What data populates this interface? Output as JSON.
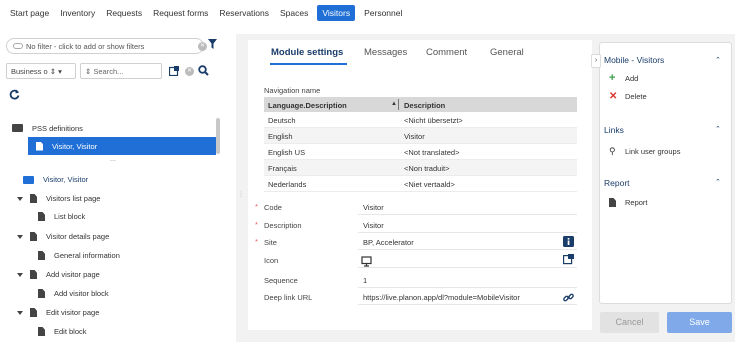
{
  "topnav": {
    "items": [
      "Start page",
      "Inventory",
      "Requests",
      "Request forms",
      "Reservations",
      "Spaces",
      "Visitors",
      "Personnel"
    ],
    "active_index": 6
  },
  "left": {
    "filter_text": "No filter - click to add or show filters",
    "business_object_label": "Business o",
    "search_placeholder": "Search...",
    "tree": {
      "root_label": "PSS definitions",
      "selected_label": "Visitor, Visitor",
      "more": "..."
    },
    "outline": [
      "Visitor, Visitor",
      "Visitors list page",
      "List block",
      "Visitor details page",
      "General information",
      "Add visitor page",
      "Add visitor block",
      "Edit visitor page",
      "Edit block"
    ]
  },
  "main": {
    "tabs": [
      "Module settings",
      "Messages",
      "Comment",
      "General"
    ],
    "active_tab": 0,
    "navigation_name_label": "Navigation name",
    "grid": {
      "headers": [
        "Language.Description",
        "Description"
      ],
      "rows": [
        [
          "Deutsch",
          "<Nicht übersetzt>"
        ],
        [
          "English",
          "Visitor"
        ],
        [
          "English US",
          "<Not translated>"
        ],
        [
          "Français",
          "<Non traduit>"
        ],
        [
          "Nederlands",
          "<Niet vertaald>"
        ]
      ]
    },
    "fields": [
      {
        "label": "Code",
        "value": "Visitor",
        "required": true
      },
      {
        "label": "Description",
        "value": "Visitor",
        "required": true
      },
      {
        "label": "Site",
        "value": "BP, Accelerator",
        "required": true
      },
      {
        "label": "Icon",
        "value": "",
        "required": false
      },
      {
        "label": "Sequence",
        "value": "1",
        "required": false
      },
      {
        "label": "Deep link URL",
        "value": "https://live.planon.app/dl?module=MobileVisitor",
        "required": false
      }
    ]
  },
  "side": {
    "sections": [
      {
        "title": "Mobile - Visitors",
        "items": [
          "Add",
          "Delete"
        ]
      },
      {
        "title": "Links",
        "items": [
          "Link user groups"
        ]
      },
      {
        "title": "Report",
        "items": [
          "Report"
        ]
      }
    ],
    "cancel_label": "Cancel",
    "save_label": "Save"
  },
  "colors": {
    "accent": "#1f6fd6",
    "panel_bg": "#f2f2f2",
    "add_icon": "#3aa04a",
    "delete_icon": "#d9382f",
    "save_button": "#7fa9e8"
  }
}
